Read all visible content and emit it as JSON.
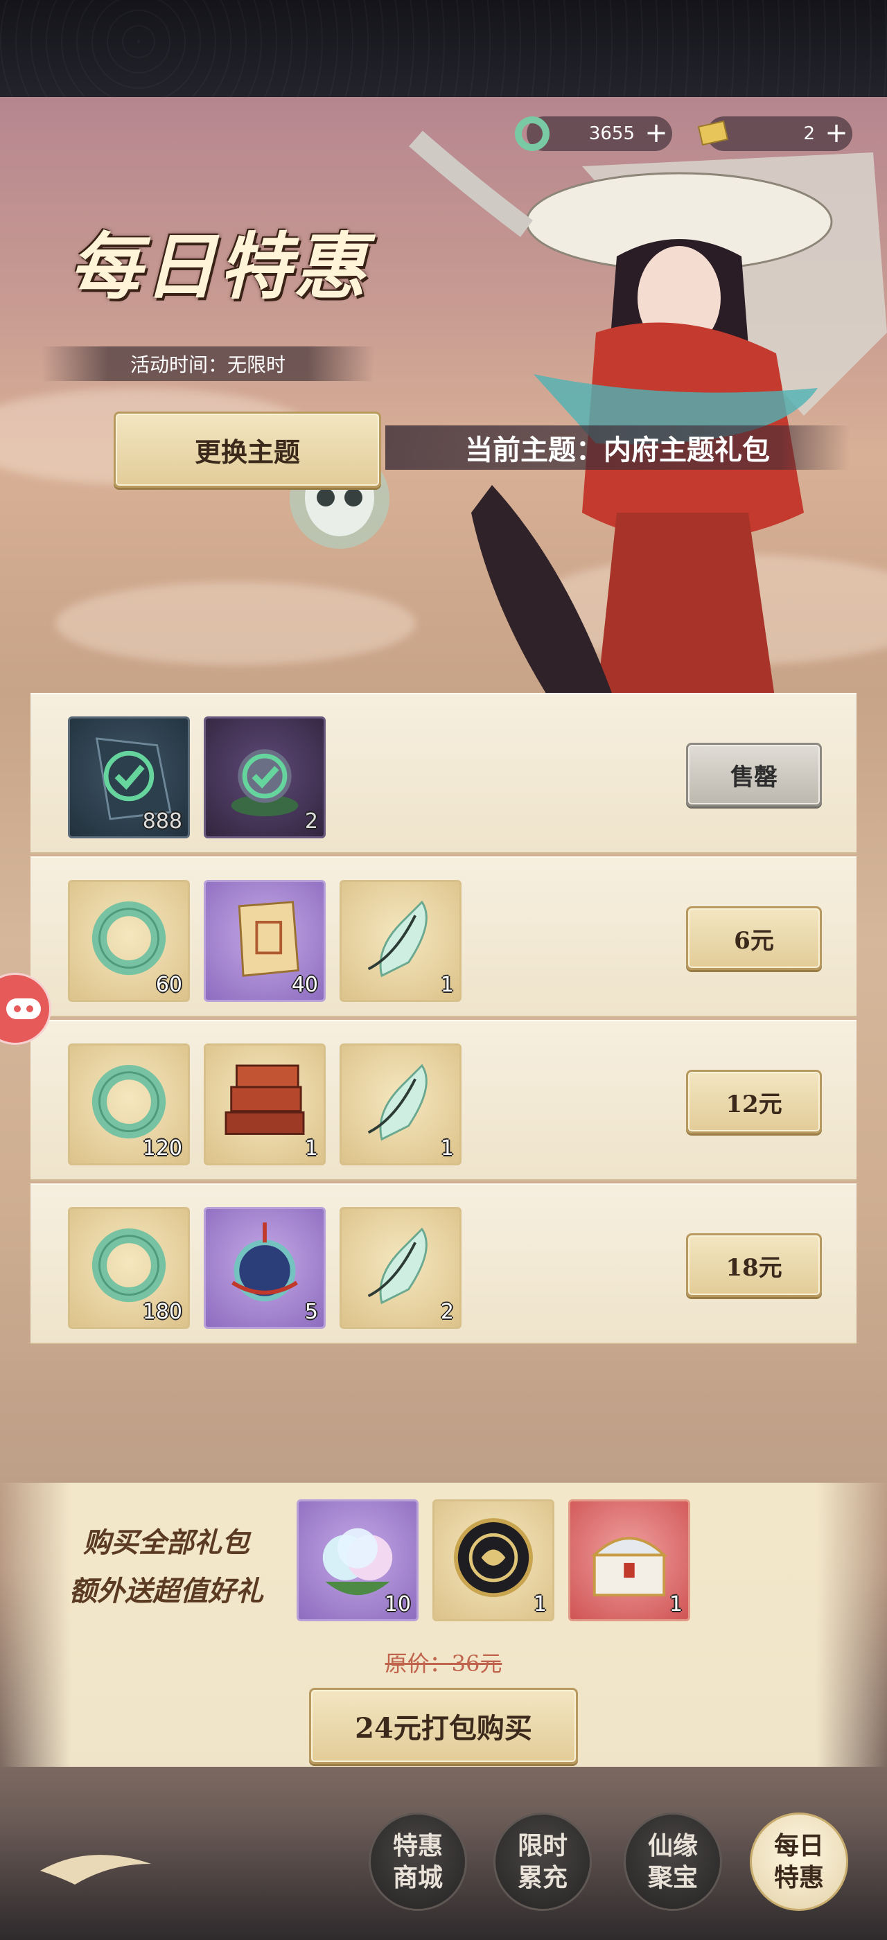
{
  "currency": [
    {
      "icon": "jade-ring-icon",
      "value": "3655",
      "add": "+"
    },
    {
      "icon": "gold-ticket-icon",
      "value": "2",
      "add": "+"
    }
  ],
  "title": "每日特惠",
  "activity_time": "活动时间：无限时",
  "change_theme": "更换主题",
  "current_theme": "当前主题：内府主题礼包",
  "rows": [
    {
      "items": [
        {
          "icon": "dark-gem-icon",
          "qty": "888",
          "bought": true
        },
        {
          "icon": "purple-lotus-icon",
          "qty": "2",
          "bought": true
        }
      ],
      "button": "售罄",
      "sold_out": true
    },
    {
      "items": [
        {
          "icon": "jade-ring-icon",
          "qty": "60"
        },
        {
          "icon": "scroll-ticket-icon",
          "qty": "40"
        },
        {
          "icon": "jade-cicada-icon",
          "qty": "1"
        }
      ],
      "button": "6元"
    },
    {
      "items": [
        {
          "icon": "jade-ring-icon",
          "qty": "120"
        },
        {
          "icon": "red-book-stack-icon",
          "qty": "1"
        },
        {
          "icon": "jade-cicada-icon",
          "qty": "1"
        }
      ],
      "button": "12元"
    },
    {
      "items": [
        {
          "icon": "jade-ring-icon",
          "qty": "180"
        },
        {
          "icon": "jade-pendant-icon",
          "qty": "5"
        },
        {
          "icon": "jade-cicada-icon",
          "qty": "2"
        }
      ],
      "button": "18元"
    }
  ],
  "bundle": {
    "line1": "购买全部礼包",
    "line2": "额外送超值好礼",
    "items": [
      {
        "icon": "spirit-peach-icon",
        "qty": "10"
      },
      {
        "icon": "black-medal-icon",
        "qty": "1"
      },
      {
        "icon": "treasure-chest-icon",
        "qty": "1"
      }
    ],
    "original_price": "原价：36元",
    "pack_button": "24元打包购买"
  },
  "nav": [
    {
      "l1": "特惠",
      "l2": "商城",
      "active": false
    },
    {
      "l1": "限时",
      "l2": "累充",
      "active": false
    },
    {
      "l1": "仙缘",
      "l2": "聚宝",
      "active": false
    },
    {
      "l1": "每日",
      "l2": "特惠",
      "active": true
    }
  ],
  "colors": {
    "gold_button": "#e9d7a8",
    "accent_red": "#c0644e",
    "nav_active": "#f3e7c6"
  }
}
